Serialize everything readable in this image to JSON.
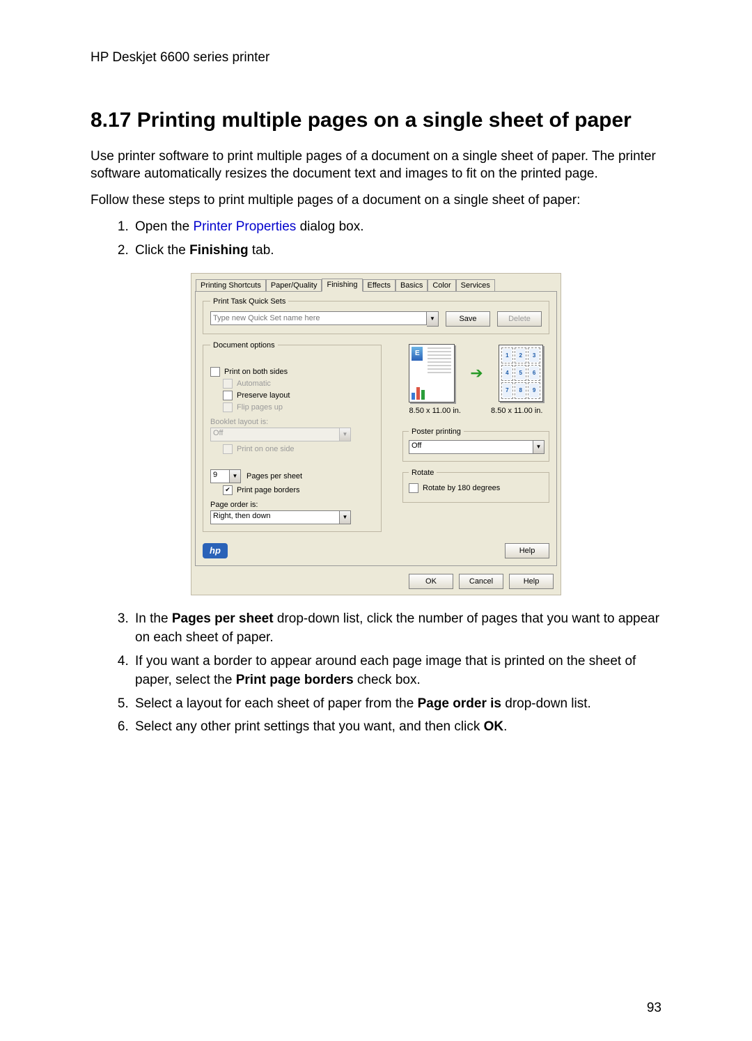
{
  "doc": {
    "header": "HP Deskjet 6600 series printer",
    "section_title": "8.17  Printing multiple pages on a single sheet of paper",
    "intro1": "Use printer software to print multiple pages of a document on a single sheet of paper. The printer software automatically resizes the document text and images to fit on the printed page.",
    "intro2": "Follow these steps to print multiple pages of a document on a single sheet of paper:",
    "step1_pre": "Open the ",
    "step1_link": "Printer Properties",
    "step1_post": " dialog box.",
    "step2_pre": "Click the ",
    "step2_bold": "Finishing",
    "step2_post": " tab.",
    "step3_pre": "In the ",
    "step3_bold": "Pages per sheet",
    "step3_post": " drop-down list, click the number of pages that you want to appear on each sheet of paper.",
    "step4_pre": "If you want a border to appear around each page image that is printed on the sheet of paper, select the ",
    "step4_bold": "Print page borders",
    "step4_post": " check box.",
    "step5_pre": "Select a layout for each sheet of paper from the ",
    "step5_bold": "Page order is",
    "step5_post": " drop-down list.",
    "step6_pre": "Select any other print settings that you want, and then click ",
    "step6_bold": "OK",
    "step6_post": ".",
    "page_number": "93"
  },
  "dialog": {
    "tabs": {
      "t0": "Printing Shortcuts",
      "t1": "Paper/Quality",
      "t2": "Finishing",
      "t3": "Effects",
      "t4": "Basics",
      "t5": "Color",
      "t6": "Services"
    },
    "quickset": {
      "legend": "Print Task Quick Sets",
      "placeholder": "Type new Quick Set name here",
      "save": "Save",
      "delete": "Delete"
    },
    "docopts": {
      "legend": "Document options",
      "both_sides": "Print on both sides",
      "automatic": "Automatic",
      "preserve": "Preserve layout",
      "flip": "Flip pages up",
      "booklet_label": "Booklet layout is:",
      "booklet_value": "Off",
      "one_side": "Print on one side",
      "pages_value": "9",
      "pages_label": "Pages per sheet",
      "borders": "Print page borders",
      "order_label": "Page order is:",
      "order_value": "Right, then down"
    },
    "preview": {
      "dim": "8.50 x 11.00 in.",
      "grid": {
        "c1": "1",
        "c2": "2",
        "c3": "3",
        "c4": "4",
        "c5": "5",
        "c6": "6",
        "c7": "7",
        "c8": "8",
        "c9": "9"
      }
    },
    "poster": {
      "legend": "Poster printing",
      "value": "Off"
    },
    "rotate": {
      "legend": "Rotate",
      "label": "Rotate by 180 degrees"
    },
    "help_inline": "Help",
    "footer": {
      "ok": "OK",
      "cancel": "Cancel",
      "help": "Help"
    }
  }
}
